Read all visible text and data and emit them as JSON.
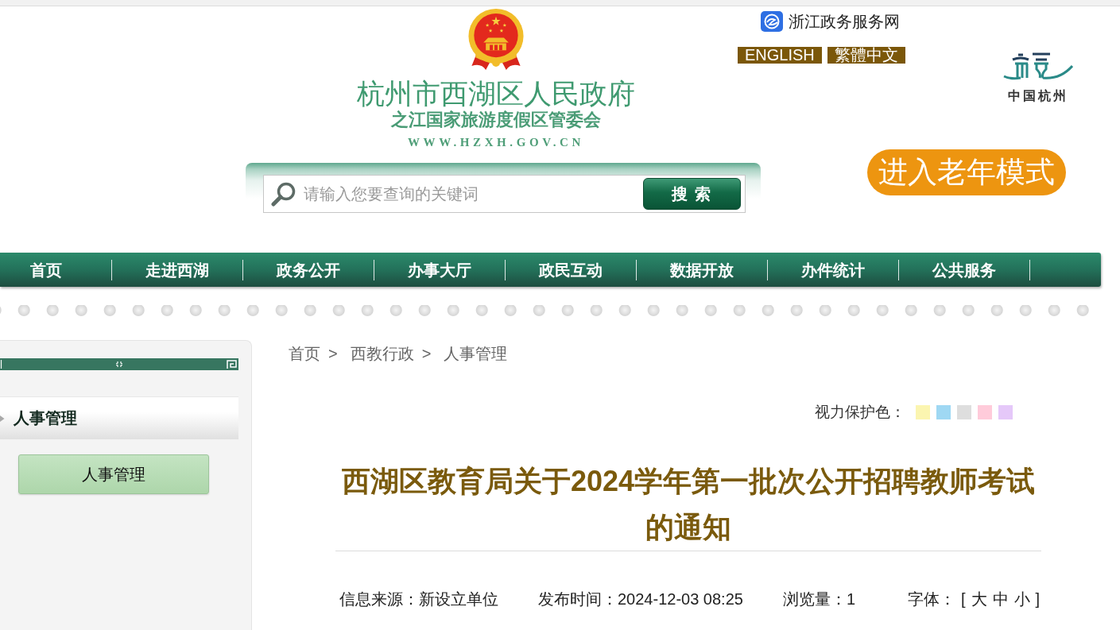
{
  "header": {
    "site_title": "杭州市西湖区人民政府",
    "site_subtitle": "之江国家旅游度假区管委会",
    "site_url": "WWW.HZXH.GOV.CN",
    "portal_link": "浙江政务服务网",
    "language_links": [
      "ENGLISH",
      "繁體中文"
    ],
    "city_logo_caption": "中国杭州",
    "search": {
      "placeholder": "请输入您要查询的关键词",
      "button": "搜 索"
    },
    "elder_mode_button": "进入老年模式"
  },
  "nav": [
    "首页",
    "走进西湖",
    "政务公开",
    "办事大厅",
    "政民互动",
    "数据开放",
    "办件统计",
    "公共服务"
  ],
  "sidebar": {
    "heading": "人事管理",
    "items": [
      {
        "label": "人事管理",
        "selected": true
      }
    ]
  },
  "breadcrumb": [
    {
      "label": "首页",
      "separator": ">"
    },
    {
      "label": "西教行政",
      "separator": ">"
    },
    {
      "label": "人事管理"
    }
  ],
  "eye_care": {
    "label": "视力保护色：",
    "swatches": [
      {
        "color": "#fbf5b0"
      },
      {
        "color": "#9fd8f3"
      },
      {
        "color": "#dedede"
      },
      {
        "color": "#ffcbda"
      },
      {
        "color": "#e5c8f9"
      }
    ]
  },
  "article": {
    "title": "西湖区教育局关于2024学年第一批次公开招聘教师考试的通知",
    "meta": [
      "信息来源：新设立单位",
      "发布时间：2024-12-03 08:25",
      "浏览量：1"
    ],
    "font_size": {
      "label": "字体：",
      "open": "[",
      "options": [
        "大",
        "中",
        "小"
      ],
      "close": "]"
    }
  }
}
